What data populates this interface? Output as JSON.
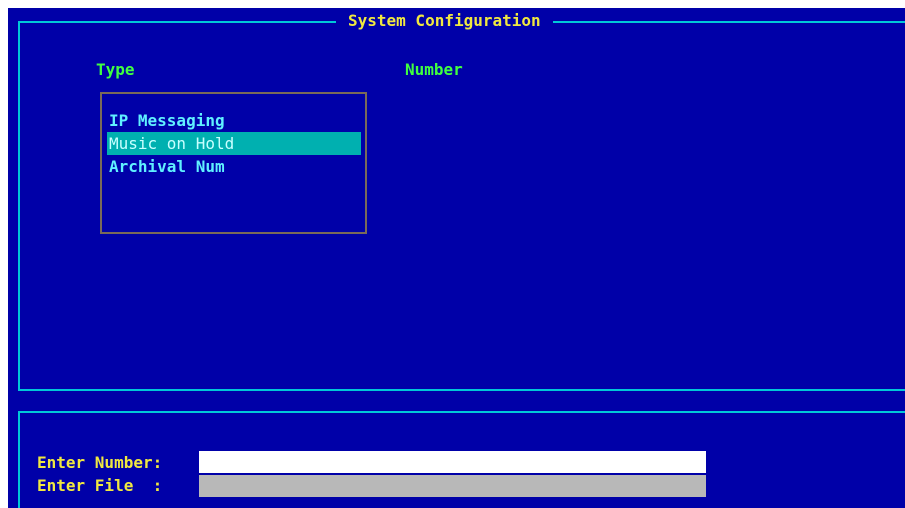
{
  "window": {
    "title": "System Configuration"
  },
  "columns": {
    "type_header": "Type",
    "number_header": "Number"
  },
  "type_list": {
    "items": [
      {
        "label": "IP Messaging",
        "selected": false
      },
      {
        "label": "Music on Hold",
        "selected": true
      },
      {
        "label": "Archival Num",
        "selected": false
      }
    ]
  },
  "inputs": {
    "number_label": "Enter Number:",
    "number_value": "",
    "file_label": "Enter File  :",
    "file_value": ""
  },
  "colors": {
    "background": "#0000a8",
    "frame": "#00c8d8",
    "title_text": "#f0e840",
    "header_text": "#40ff40",
    "list_text": "#60f0ff",
    "selection": "#00b0b0",
    "number_field": "#ffffff",
    "file_field": "#b8b8b8"
  }
}
